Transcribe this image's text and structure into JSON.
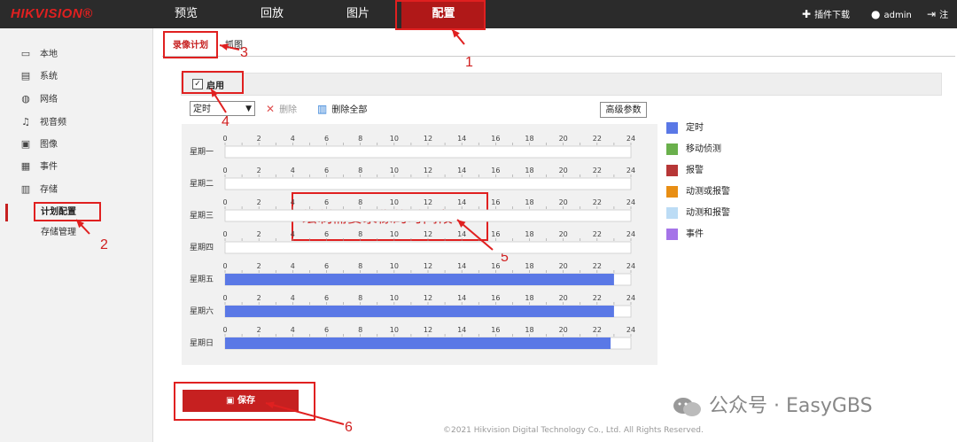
{
  "header": {
    "logo": "HIKVISION®",
    "nav": [
      "预览",
      "回放",
      "图片",
      "配置"
    ],
    "active_nav": "配置",
    "plugin_download": "插件下载",
    "user": "admin",
    "logout": "注销"
  },
  "sidebar": {
    "items": [
      {
        "label": "本地",
        "icon": "monitor-icon"
      },
      {
        "label": "系统",
        "icon": "window-icon"
      },
      {
        "label": "网络",
        "icon": "globe-icon"
      },
      {
        "label": "视音频",
        "icon": "audio-video-icon"
      },
      {
        "label": "图像",
        "icon": "image-icon"
      },
      {
        "label": "事件",
        "icon": "calendar-icon"
      },
      {
        "label": "存储",
        "icon": "storage-icon"
      }
    ],
    "subitems": [
      {
        "label": "计划配置",
        "active": true
      },
      {
        "label": "存储管理",
        "active": false
      }
    ]
  },
  "tabs": [
    {
      "label": "录像计划",
      "active": true
    },
    {
      "label": "抓图",
      "active": false
    }
  ],
  "enable": {
    "label": "启用",
    "checked": true
  },
  "toolbar": {
    "select_value": "定时",
    "delete_label": "删除",
    "delete_all_label": "删除全部",
    "advanced_label": "高级参数"
  },
  "schedule": {
    "ticks": [
      "0",
      "2",
      "4",
      "6",
      "8",
      "10",
      "12",
      "14",
      "16",
      "18",
      "20",
      "22",
      "24"
    ],
    "days": [
      {
        "label": "星期一",
        "ranges": []
      },
      {
        "label": "星期二",
        "ranges": []
      },
      {
        "label": "星期三",
        "ranges": []
      },
      {
        "label": "星期四",
        "ranges": []
      },
      {
        "label": "星期五",
        "ranges": [
          [
            0,
            23
          ]
        ]
      },
      {
        "label": "星期六",
        "ranges": [
          [
            0,
            23
          ]
        ]
      },
      {
        "label": "星期日",
        "ranges": [
          [
            0,
            22.8
          ]
        ]
      }
    ]
  },
  "legend": [
    {
      "label": "定时",
      "color": "#5a78e6"
    },
    {
      "label": "移动侦测",
      "color": "#6ab04c"
    },
    {
      "label": "报警",
      "color": "#b73737"
    },
    {
      "label": "动测或报警",
      "color": "#e88e14"
    },
    {
      "label": "动测和报警",
      "color": "#bcdcf5"
    },
    {
      "label": "事件",
      "color": "#a574e8"
    }
  ],
  "save_label": "保存",
  "footer": "©2021 Hikvision Digital Technology Co., Ltd. All Rights Reserved.",
  "annotations": {
    "numbers": [
      "1",
      "2",
      "3",
      "4",
      "5",
      "6"
    ],
    "text": "绘制需要录像的时间段",
    "color": "#e02020"
  },
  "watermark": "公众号 · EasyGBS"
}
